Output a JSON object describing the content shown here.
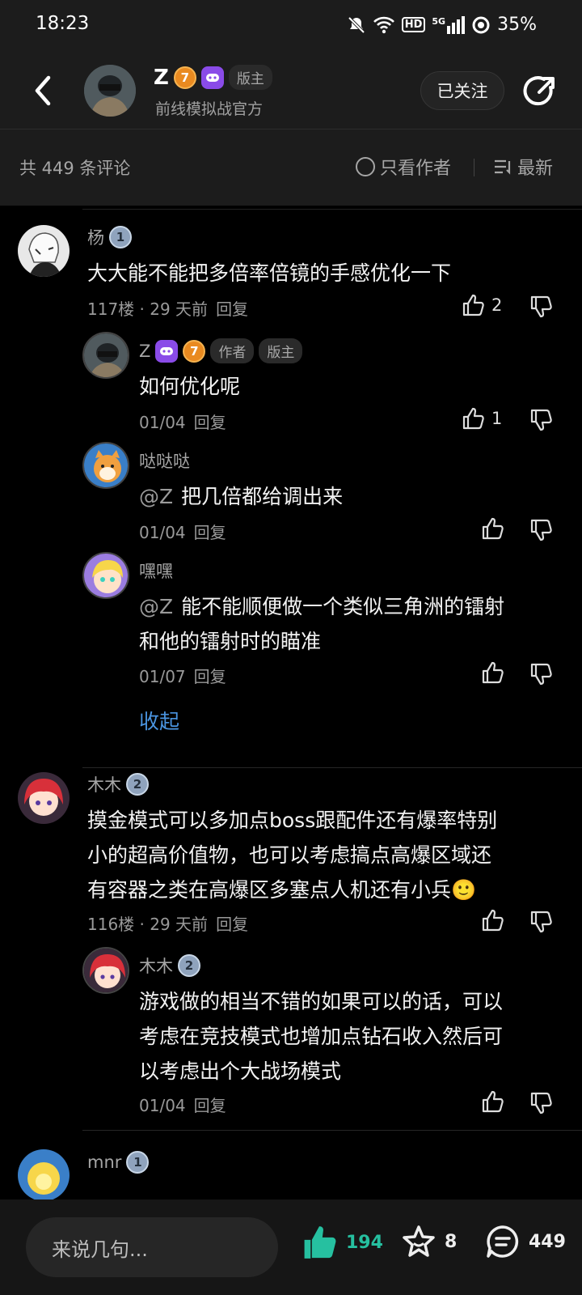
{
  "status": {
    "time": "18:23",
    "battery": "35%",
    "net_hd": "HD",
    "net_gen": "5G"
  },
  "header": {
    "name": "Z",
    "level_badge": "7",
    "role_chip": "版主",
    "subtitle": "前线模拟战官方",
    "follow_label": "已关注"
  },
  "comment_bar": {
    "count_label": "共 449 条评论",
    "only_author_label": "只看作者",
    "sort_label": "最新"
  },
  "comments": [
    {
      "name": "杨",
      "level": "1",
      "text": "大大能不能把多倍率倍镜的手感优化一下",
      "meta": "117楼 · 29 天前",
      "reply": "回复",
      "likes": "2",
      "replies": [
        {
          "name": "Z",
          "level": "7",
          "chip1": "作者",
          "chip2": "版主",
          "text": "如何优化呢",
          "date": "01/04",
          "reply": "回复",
          "likes": "1"
        },
        {
          "name": "哒哒哒",
          "mention": "@Z",
          "text": "把几倍都给调出来",
          "date": "01/04",
          "reply": "回复"
        },
        {
          "name": "嘿嘿",
          "mention": "@Z",
          "text_line1": "能不能顺便做一个类似三角洲的镭射",
          "text_line2": "和他的镭射时的瞄准",
          "date": "01/07",
          "reply": "回复"
        }
      ],
      "collapse": "收起"
    },
    {
      "name": "木木",
      "level": "2",
      "text_line1": "摸金模式可以多加点boss跟配件还有爆率特别",
      "text_line2": "小的超高价值物，也可以考虑搞点高爆区域还",
      "text_line3": "有容器之类在高爆区多塞点人机还有小兵🙂",
      "meta": "116楼 · 29 天前",
      "reply": "回复",
      "replies": [
        {
          "name": "木木",
          "level": "2",
          "text_line1": "游戏做的相当不错的如果可以的话，可以",
          "text_line2": "考虑在竞技模式也增加点钻石收入然后可",
          "text_line3": "以考虑出个大战场模式",
          "date": "01/04",
          "reply": "回复"
        }
      ]
    },
    {
      "name": "mnr",
      "level": "1"
    }
  ],
  "bottom_bar": {
    "input_placeholder": "来说几句...",
    "like_count": "194",
    "star_count": "8",
    "comment_count": "449"
  },
  "colors": {
    "accent_teal": "#26c0a0",
    "link_blue": "#4a94e0",
    "badge_purple": "#8a4be8",
    "badge_orange": "#e98a20"
  }
}
